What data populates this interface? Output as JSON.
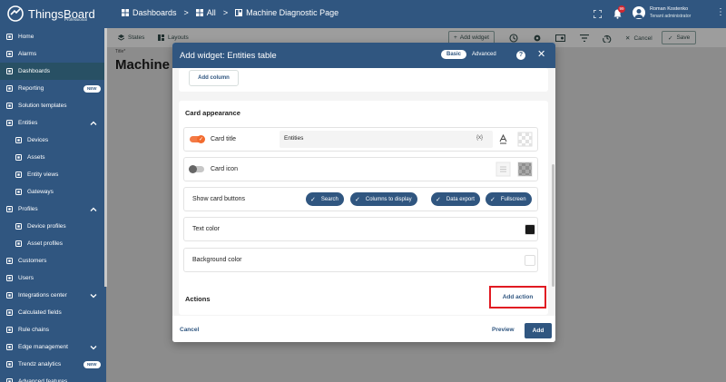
{
  "colors": {
    "brand": "#305680",
    "sidebar": "#305680",
    "accent_orange": "#f26b2e",
    "highlight_red": "#e11a22"
  },
  "app": {
    "logo_text": "ThingsBoard",
    "logo_sub": "Professional"
  },
  "breadcrumb": {
    "item1": "Dashboards",
    "item2": "All",
    "item3": "Machine Diagnostic Page",
    "sep": ">"
  },
  "topbar": {
    "notification_count": "99",
    "user_name": "Roman Kostenko",
    "user_role": "Tenant administrator"
  },
  "sidebar": {
    "items": [
      {
        "label": "Home",
        "icon": "home-icon"
      },
      {
        "label": "Alarms",
        "icon": "alarm-icon"
      },
      {
        "label": "Dashboards",
        "icon": "dashboards-icon",
        "active": true
      },
      {
        "label": "Reporting",
        "icon": "reporting-icon",
        "badge": "NEW"
      },
      {
        "label": "Solution templates",
        "icon": "templates-icon"
      },
      {
        "label": "Entities",
        "icon": "entities-icon"
      },
      {
        "label": "Devices",
        "icon": "devices-icon"
      },
      {
        "label": "Assets",
        "icon": "assets-icon"
      },
      {
        "label": "Entity views",
        "icon": "entity-views-icon"
      },
      {
        "label": "Gateways",
        "icon": "gateways-icon"
      },
      {
        "label": "Profiles",
        "icon": "profiles-icon"
      },
      {
        "label": "Device profiles",
        "icon": "device-profiles-icon"
      },
      {
        "label": "Asset profiles",
        "icon": "asset-profiles-icon"
      },
      {
        "label": "Customers",
        "icon": "customers-icon"
      },
      {
        "label": "Users",
        "icon": "users-icon"
      },
      {
        "label": "Integrations center",
        "icon": "integrations-icon"
      },
      {
        "label": "Calculated fields",
        "icon": "calculated-fields-icon"
      },
      {
        "label": "Rule chains",
        "icon": "rule-chains-icon"
      },
      {
        "label": "Edge management",
        "icon": "edge-icon"
      },
      {
        "label": "Trendz analytics",
        "icon": "trendz-icon",
        "badge": "NEW"
      },
      {
        "label": "Advanced features",
        "icon": "advanced-features-icon"
      }
    ]
  },
  "dash_toolbar": {
    "states": "States",
    "layouts": "Layouts",
    "add_widget": "Add widget",
    "cancel": "Cancel",
    "save": "Save"
  },
  "dashboard": {
    "title_small": "Title*",
    "title": "Machine D"
  },
  "dialog": {
    "title": "Add widget: Entities table",
    "mode_basic": "Basic",
    "mode_advanced": "Advanced",
    "add_column": "Add column",
    "card_appearance": "Card appearance",
    "card_title_label": "Card title",
    "card_title_value": "Entities",
    "fx": "{x}",
    "card_icon_label": "Card icon",
    "card_buttons_label": "Show card buttons",
    "card_buttons": [
      "Search",
      "Columns to display",
      "Data export",
      "Fullscreen"
    ],
    "text_color_label": "Text color",
    "background_color_label": "Background color",
    "text_color_value": "#1a1a1a",
    "background_color_value": "#ffffff",
    "actions_label": "Actions",
    "add_action": "Add action",
    "cancel": "Cancel",
    "preview": "Preview",
    "add": "Add"
  }
}
